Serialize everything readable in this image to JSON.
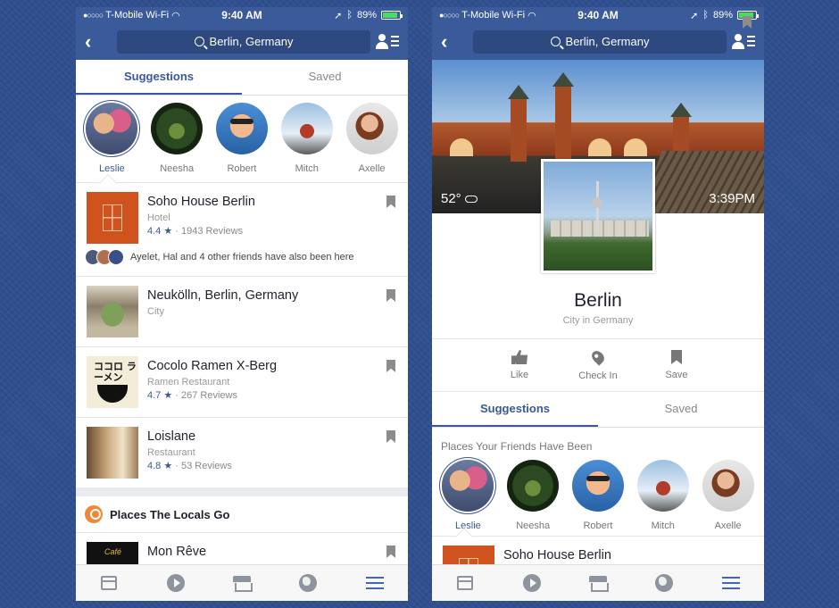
{
  "status_bar": {
    "dots": "●○○○○",
    "carrier": "T-Mobile Wi-Fi",
    "time": "9:40 AM",
    "battery": "89%",
    "battery_level": 0.89
  },
  "nav": {
    "back_icon": "chevron-left-icon",
    "search_text": "Berlin, Germany",
    "people_icon": "friends-list-icon"
  },
  "left": {
    "tabs": [
      {
        "label": "Suggestions",
        "active": true
      },
      {
        "label": "Saved",
        "active": false
      }
    ],
    "friends": [
      {
        "name": "Leslie",
        "selected": true
      },
      {
        "name": "Neesha"
      },
      {
        "name": "Robert"
      },
      {
        "name": "Mitch"
      },
      {
        "name": "Axelle"
      }
    ],
    "places": [
      {
        "title": "Soho House Berlin",
        "category": "Hotel",
        "rating": "4.4 ★",
        "reviews": "· 1943 Reviews"
      },
      {
        "title": "Neukölln, Berlin, Germany",
        "category": "City"
      },
      {
        "title": "Cocolo Ramen X-Berg",
        "category": "Ramen Restaurant",
        "rating": "4.7 ★",
        "reviews": "· 267 Reviews"
      },
      {
        "title": "Loislane",
        "category": "Restaurant",
        "rating": "4.8 ★",
        "reviews": "· 53 Reviews"
      }
    ],
    "friends_been_here": "Ayelet, Hal and 4 other friends have also been here",
    "cocolo_logo_text": "ココロ ラーメン",
    "section_title": "Places The Locals Go",
    "partial_item": "Mon Rêve",
    "partial_logo": "Café"
  },
  "right": {
    "weather": "52°",
    "local_time": "3:39PM",
    "place_name": "Berlin",
    "place_sub": "City in Germany",
    "actions": [
      {
        "label": "Like",
        "icon": "thumbs-up-icon"
      },
      {
        "label": "Check In",
        "icon": "location-pin-icon"
      },
      {
        "label": "Save",
        "icon": "bookmark-icon"
      }
    ],
    "tabs": [
      {
        "label": "Suggestions",
        "active": true
      },
      {
        "label": "Saved",
        "active": false
      }
    ],
    "friends_heading": "Places Your Friends Have Been",
    "friends": [
      {
        "name": "Leslie",
        "selected": true
      },
      {
        "name": "Neesha"
      },
      {
        "name": "Robert"
      },
      {
        "name": "Mitch"
      },
      {
        "name": "Axelle"
      }
    ],
    "partial_item": "Soho House Berlin"
  },
  "tabbar": [
    "news-feed-icon",
    "video-icon",
    "marketplace-icon",
    "globe-icon",
    "menu-icon"
  ],
  "colors": {
    "brand": "#3b5998",
    "nav_bg": "#3b5a9a",
    "accent_orange": "#f0883a"
  }
}
